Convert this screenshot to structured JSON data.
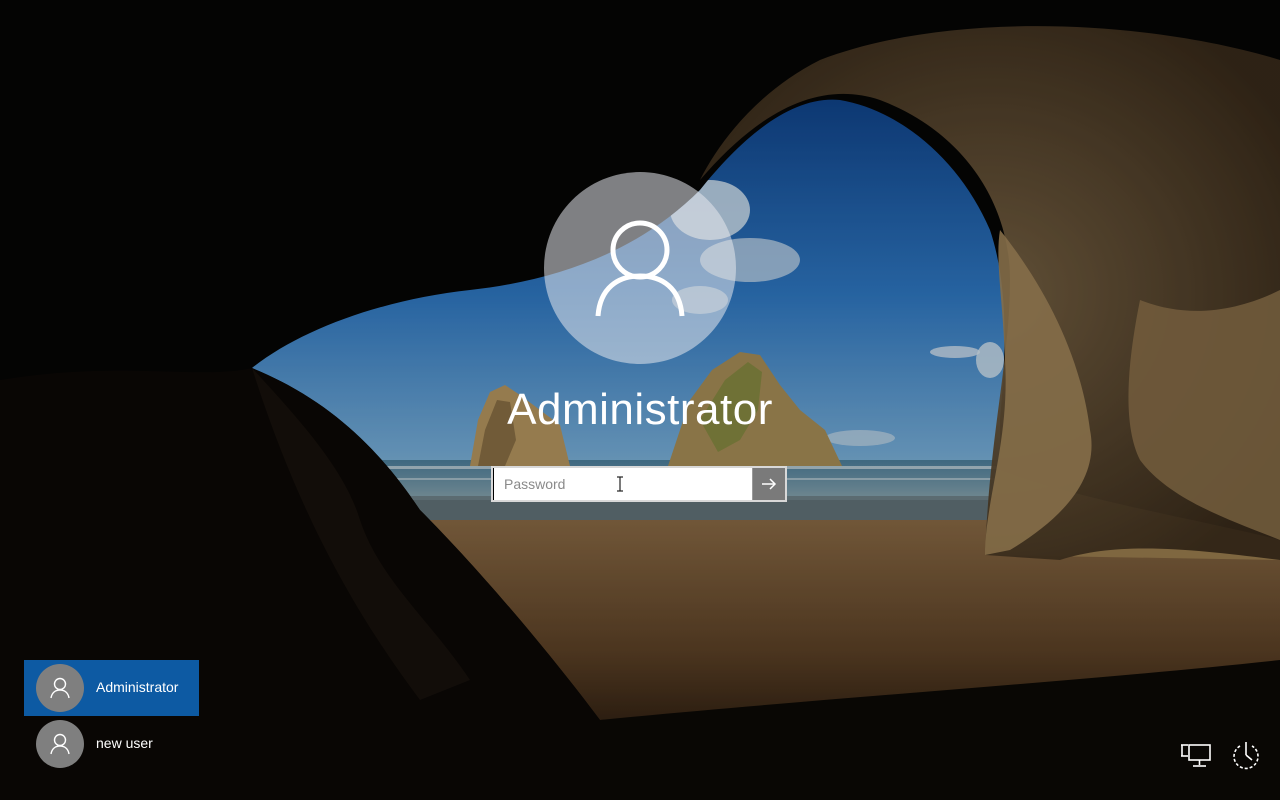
{
  "lock_screen": {
    "username": "Administrator",
    "password": {
      "placeholder": "Password",
      "value": ""
    },
    "submit_icon": "arrow-right-icon",
    "avatar_icon": "user-silhouette-icon"
  },
  "user_list": [
    {
      "label": "Administrator",
      "selected": true,
      "icon": "user-silhouette-icon"
    },
    {
      "label": "new user",
      "selected": false,
      "icon": "user-silhouette-icon"
    }
  ],
  "tray": {
    "network_icon": "network-icon",
    "power_icon": "power-icon"
  },
  "colors": {
    "selected_tile": "#0d5aa3",
    "avatar_bg": "#7f7f7f",
    "submit_bg": "#7a7a7a"
  }
}
